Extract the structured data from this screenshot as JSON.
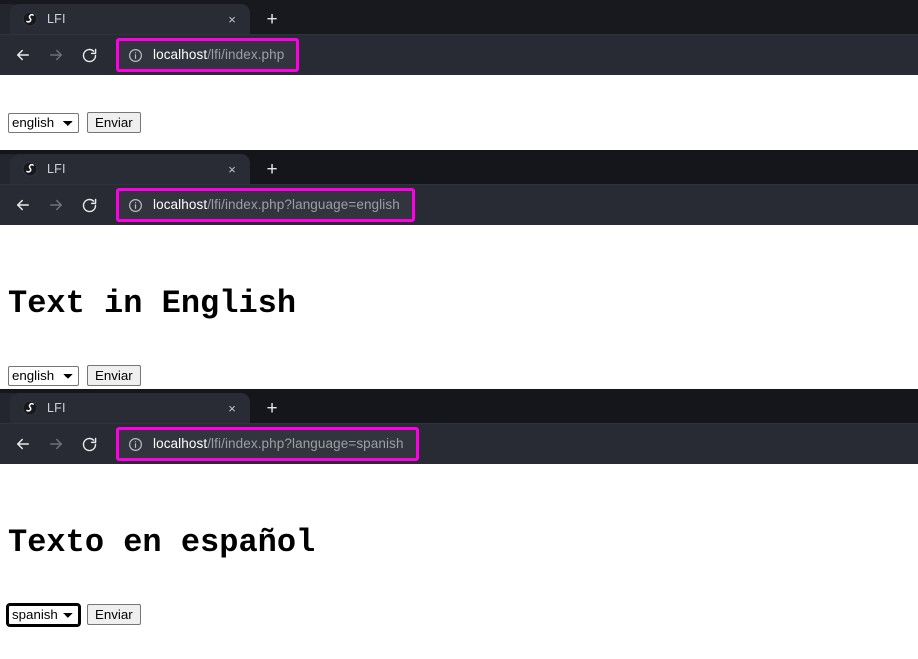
{
  "browser": {
    "tab_title": "LFI",
    "favicon_name": "globe-favicon",
    "close_label": "×",
    "newtab_label": "+",
    "back_label": "Back",
    "forward_label": "Forward",
    "reload_label": "Reload",
    "info_label": "Site information"
  },
  "colors": {
    "highlight": "#ff00e6",
    "tabstrip_bg": "#17191f",
    "toolbar_bg": "#282b33",
    "omnibox_bg": "#32353d",
    "url_host": "#ffffff",
    "url_path": "#9aa0a6",
    "page_bg": "#ffffff",
    "button_bg": "#efefef"
  },
  "form": {
    "submit_label": "Enviar",
    "options": [
      "english",
      "spanish"
    ]
  },
  "panels": [
    {
      "id": "panel-1",
      "url": {
        "host": "localhost",
        "path": "/lfi/index.php"
      },
      "heading": "",
      "select_value": "english",
      "select_focused": false
    },
    {
      "id": "panel-2",
      "url": {
        "host": "localhost",
        "path": "/lfi/index.php?language=english"
      },
      "heading": "Text in English",
      "select_value": "english",
      "select_focused": false
    },
    {
      "id": "panel-3",
      "url": {
        "host": "localhost",
        "path": "/lfi/index.php?language=spanish"
      },
      "heading": "Texto en español",
      "select_value": "spanish",
      "select_focused": true
    }
  ]
}
